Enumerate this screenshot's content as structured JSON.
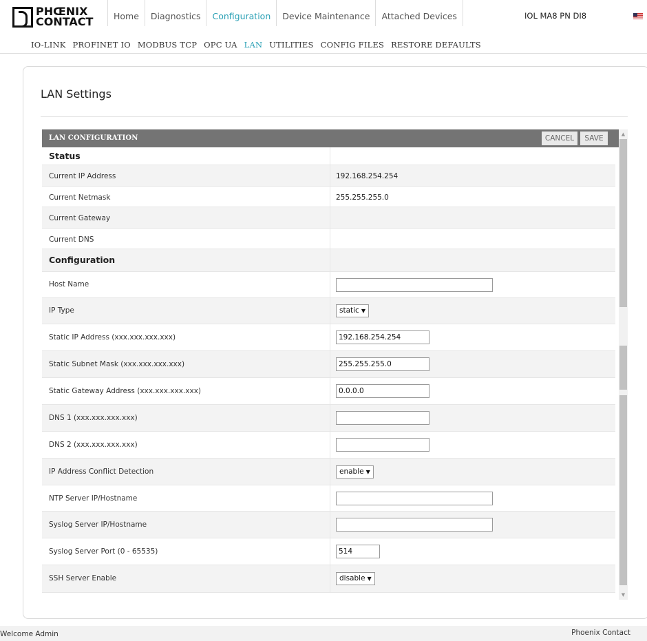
{
  "brand": {
    "line1": "PHŒNIX",
    "line2": "CONTACT"
  },
  "nav": {
    "tabs": [
      {
        "label": "Home"
      },
      {
        "label": "Diagnostics"
      },
      {
        "label": "Configuration"
      },
      {
        "label": "Device Maintenance"
      },
      {
        "label": "Attached Devices"
      }
    ],
    "active_tab": "Configuration",
    "device_name": "IOL MA8 PN DI8",
    "language_flag": "us-flag-icon"
  },
  "subnav": {
    "items": [
      {
        "label": "IO-LINK"
      },
      {
        "label": "PROFINET IO"
      },
      {
        "label": "MODBUS TCP"
      },
      {
        "label": "OPC UA"
      },
      {
        "label": "LAN"
      },
      {
        "label": "UTILITIES"
      },
      {
        "label": "CONFIG FILES"
      },
      {
        "label": "RESTORE DEFAULTS"
      }
    ],
    "active_item": "LAN"
  },
  "page": {
    "title": "LAN Settings"
  },
  "panel": {
    "title": "LAN CONFIGURATION",
    "cancel_label": "CANCEL",
    "save_label": "SAVE",
    "status_section": "Status",
    "config_section": "Configuration",
    "status": {
      "current_ip_label": "Current IP Address",
      "current_ip_value": "192.168.254.254",
      "current_netmask_label": "Current Netmask",
      "current_netmask_value": "255.255.255.0",
      "current_gateway_label": "Current Gateway",
      "current_gateway_value": "",
      "current_dns_label": "Current DNS",
      "current_dns_value": ""
    },
    "config": {
      "host_name_label": "Host Name",
      "host_name_value": "",
      "ip_type_label": "IP Type",
      "ip_type_value": "static",
      "static_ip_label": "Static IP Address (xxx.xxx.xxx.xxx)",
      "static_ip_value": "192.168.254.254",
      "static_mask_label": "Static Subnet Mask (xxx.xxx.xxx.xxx)",
      "static_mask_value": "255.255.255.0",
      "static_gateway_label": "Static Gateway Address (xxx.xxx.xxx.xxx)",
      "static_gateway_value": "0.0.0.0",
      "dns1_label": "DNS 1 (xxx.xxx.xxx.xxx)",
      "dns1_value": "",
      "dns2_label": "DNS 2 (xxx.xxx.xxx.xxx)",
      "dns2_value": "",
      "conflict_label": "IP Address Conflict Detection",
      "conflict_value": "enable",
      "ntp_label": "NTP Server IP/Hostname",
      "ntp_value": "",
      "syslog_label": "Syslog Server IP/Hostname",
      "syslog_value": "",
      "syslog_port_label": "Syslog Server Port (0 - 65535)",
      "syslog_port_value": "514",
      "ssh_label": "SSH Server Enable",
      "ssh_value": "disable"
    }
  },
  "footer": {
    "welcome": "Welcome Admin",
    "company": "Phoenix Contact"
  }
}
